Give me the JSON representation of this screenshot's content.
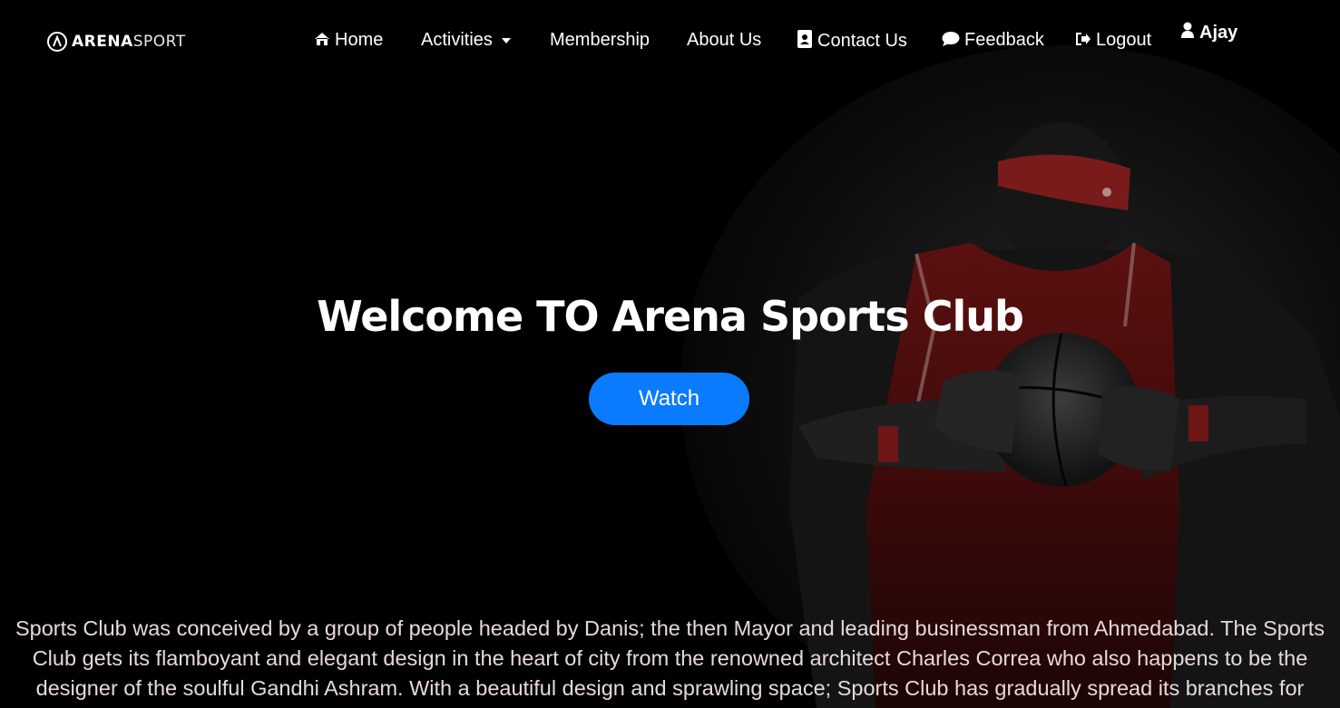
{
  "brand": {
    "bold": "ARENA",
    "light": "SPORT",
    "icon": "arena-logo-icon"
  },
  "nav": {
    "home": {
      "label": "Home",
      "icon": "home-icon"
    },
    "activities": {
      "label": "Activities",
      "icon": "chevron-down-icon"
    },
    "membership": {
      "label": "Membership"
    },
    "about": {
      "label": "About Us"
    },
    "contact": {
      "label": "Contact Us",
      "icon": "contact-book-icon"
    },
    "feedback": {
      "label": "Feedback",
      "icon": "chat-bubble-icon"
    },
    "logout": {
      "label": "Logout",
      "icon": "logout-icon"
    },
    "user": {
      "label": "Ajay",
      "icon": "user-icon"
    }
  },
  "hero": {
    "title": "Welcome TO Arena Sports Club",
    "button": "Watch"
  },
  "about": {
    "text": "Sports Club was conceived by a group of people headed by Danis; the then Mayor and leading businessman from Ahmedabad. The Sports Club gets its flamboyant and elegant design in the heart of city from the renowned architect Charles Correa who also happens to be the designer of the soulful Gandhi Ashram. With a beautiful design and sprawling space; Sports Club has gradually spread its branches for"
  },
  "colors": {
    "background": "#000000",
    "button": "#0a7bff",
    "jersey": "#8c1a1a",
    "text": "#ffffff",
    "about_text": "#e7d9d9"
  }
}
